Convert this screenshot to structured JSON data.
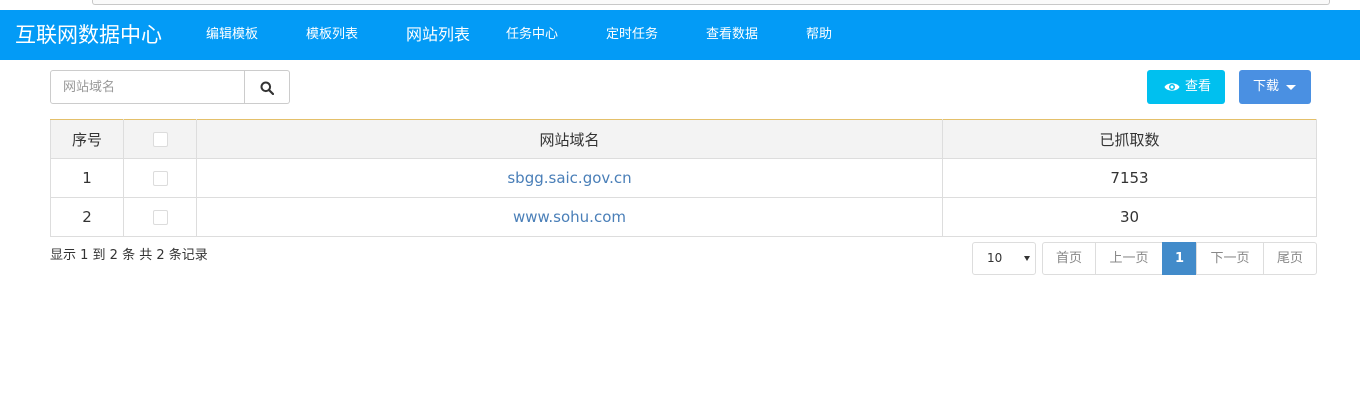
{
  "nav": {
    "brand": "互联网数据中心",
    "items": [
      {
        "label": "编辑模板"
      },
      {
        "label": "模板列表"
      },
      {
        "label": "网站列表"
      },
      {
        "label": "任务中心"
      },
      {
        "label": "定时任务"
      },
      {
        "label": "查看数据"
      },
      {
        "label": "帮助"
      }
    ]
  },
  "toolbar": {
    "search_placeholder": "网站域名",
    "search_icon": "search-icon",
    "view_label": "查看",
    "view_icon": "eye-icon",
    "download_label": "下载"
  },
  "table": {
    "headers": [
      "序号",
      "",
      "网站域名",
      "已抓取数"
    ],
    "rows": [
      {
        "index": "1",
        "domain": "sbgg.saic.gov.cn",
        "count": "7153"
      },
      {
        "index": "2",
        "domain": "www.sohu.com",
        "count": "30"
      }
    ]
  },
  "footer": {
    "summary": "显示 1 到 2 条 共 2 条记录",
    "page_size": "10",
    "pager": {
      "first": "首页",
      "prev": "上一页",
      "current": "1",
      "next": "下一页",
      "last": "尾页"
    }
  },
  "colors": {
    "navbar": "#039bf6",
    "view_button": "#00c0ef",
    "download_button": "#4a90e2",
    "active_page": "#428bca",
    "header_top_border": "#e4c06a"
  }
}
